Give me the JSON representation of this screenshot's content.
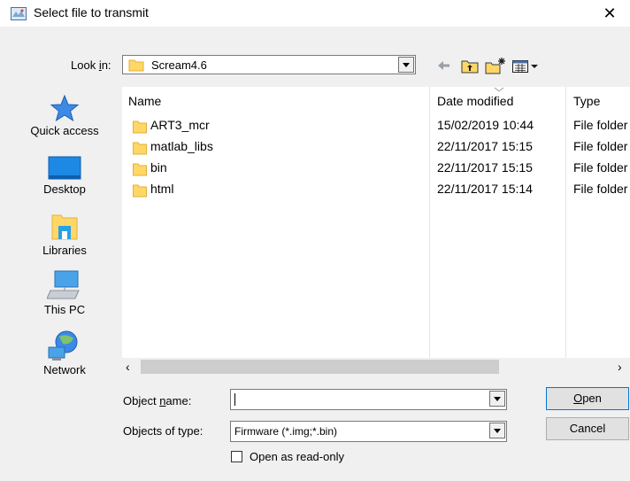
{
  "window": {
    "title": "Select file to transmit",
    "close_glyph": "✕"
  },
  "lookin": {
    "label_pre": "Look ",
    "label_u": "i",
    "label_post": "n:",
    "value": "Scream4.6"
  },
  "toolbar": {
    "back_icon": "arrow-left-icon",
    "up_icon": "up-folder-icon",
    "new_folder_icon": "new-folder-icon",
    "view_menu_icon": "view-menu-icon"
  },
  "places": [
    {
      "label": "Quick access",
      "icon": "star-icon"
    },
    {
      "label": "Desktop",
      "icon": "desktop-icon"
    },
    {
      "label": "Libraries",
      "icon": "libraries-icon"
    },
    {
      "label": "This PC",
      "icon": "computer-icon"
    },
    {
      "label": "Network",
      "icon": "network-icon"
    }
  ],
  "columns": {
    "name": "Name",
    "date": "Date modified",
    "type": "Type"
  },
  "files": [
    {
      "name": "ART3_mcr",
      "date": "15/02/2019 10:44",
      "type": "File folder"
    },
    {
      "name": "matlab_libs",
      "date": "22/11/2017 15:15",
      "type": "File folder"
    },
    {
      "name": "bin",
      "date": "22/11/2017 15:15",
      "type": "File folder"
    },
    {
      "name": "html",
      "date": "22/11/2017 15:14",
      "type": "File folder"
    }
  ],
  "scroll": {
    "left": "‹",
    "right": "›"
  },
  "object_name": {
    "label_pre": "Object ",
    "label_u": "n",
    "label_post": "ame:",
    "value": "",
    "placeholder": ""
  },
  "object_type": {
    "label": "Objects of type:",
    "value": "Firmware (*.img;*.bin)"
  },
  "buttons": {
    "open_u": "O",
    "open_rest": "pen",
    "cancel": "Cancel"
  },
  "readonly": {
    "label": "Open as read-only",
    "checked": false
  },
  "colors": {
    "accent": "#0078d7",
    "folder": "#ffd766",
    "star": "#3b8ae6"
  }
}
